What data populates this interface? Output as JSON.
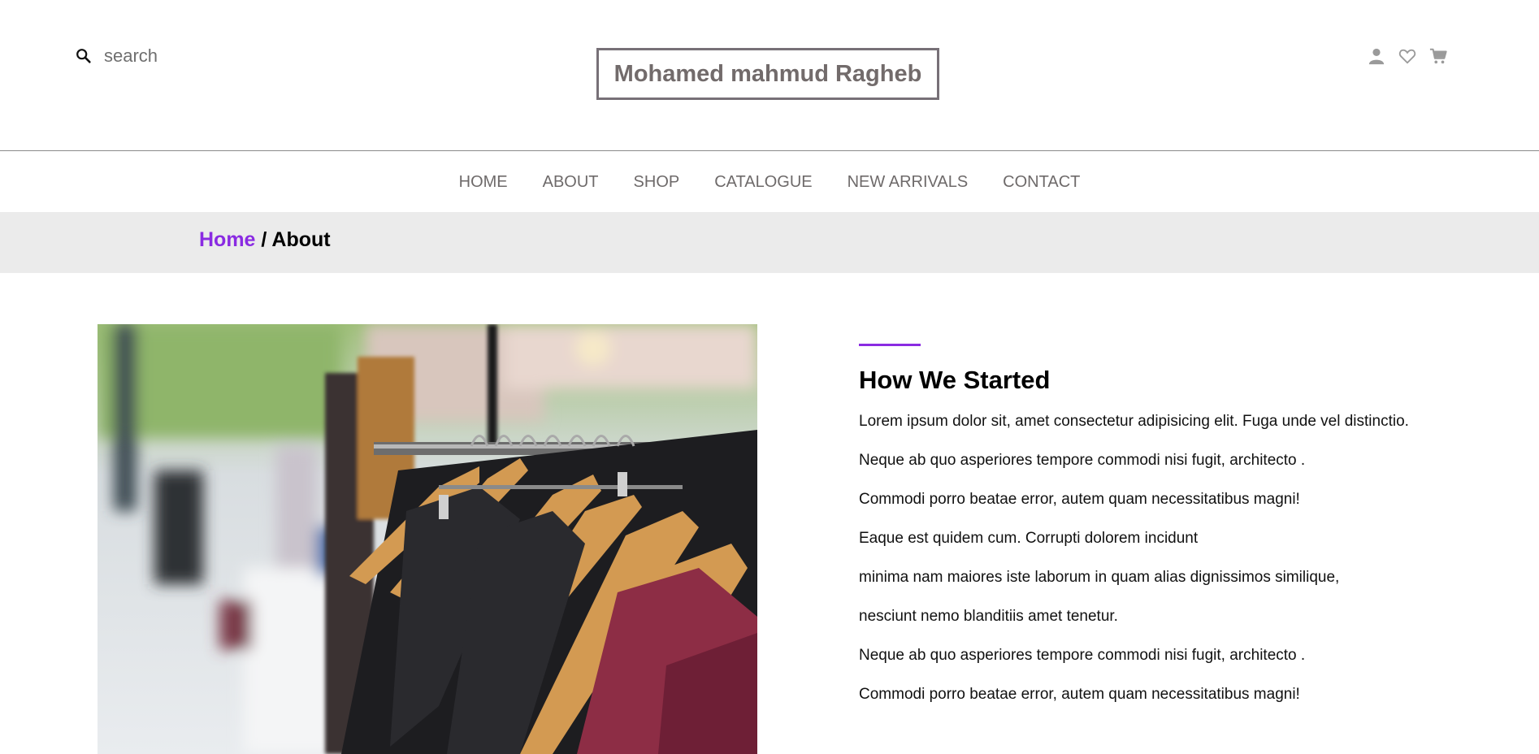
{
  "search": {
    "placeholder": "search",
    "icon": "search-icon"
  },
  "brand": {
    "name": "Mohamed mahmud Ragheb"
  },
  "header_icons": [
    "user-icon",
    "heart-icon",
    "cart-icon"
  ],
  "nav": {
    "items": [
      "HOME",
      "ABOUT",
      "SHOP",
      "CATALOGUE",
      "NEW ARRIVALS",
      "CONTACT"
    ]
  },
  "breadcrumb": {
    "home": "Home",
    "separator": " / ",
    "current": "About"
  },
  "hero": {
    "image": "clothing-rack-image"
  },
  "about": {
    "title": "How We Started",
    "paragraphs": [
      "Lorem ipsum dolor sit, amet consectetur adipisicing elit. Fuga unde vel distinctio.",
      "Neque ab quo asperiores tempore commodi nisi fugit, architecto .",
      "Commodi porro beatae error, autem quam necessitatibus magni!",
      "Eaque est quidem cum. Corrupti dolorem incidunt",
      "minima nam maiores iste laborum in quam alias dignissimos similique,",
      "nesciunt nemo blanditiis amet tenetur.",
      "Neque ab quo asperiores tempore commodi nisi fugit, architecto .",
      "Commodi porro beatae error, autem quam necessitatibus magni!"
    ]
  },
  "colors": {
    "accent": "#8a2be2",
    "muted_text": "#6e6a6a",
    "breadcrumb_bg": "#ebebeb",
    "icon_gray": "#9a9a9a"
  }
}
